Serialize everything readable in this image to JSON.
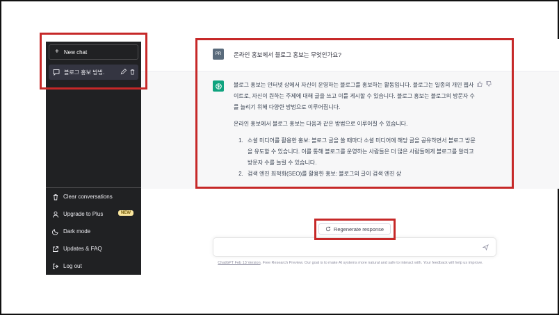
{
  "sidebar": {
    "new_chat_label": "New chat",
    "conversation_title": "블로그 홍보 방법.",
    "menu": [
      {
        "label": "Clear conversations",
        "icon": "trash-icon"
      },
      {
        "label": "Upgrade to Plus",
        "icon": "user-icon",
        "badge": "NEW"
      },
      {
        "label": "Dark mode",
        "icon": "moon-icon"
      },
      {
        "label": "Updates & FAQ",
        "icon": "external-link-icon"
      },
      {
        "label": "Log out",
        "icon": "logout-icon"
      }
    ]
  },
  "conversation": {
    "user_avatar": "PR",
    "question": "온라인 홍보에서 블로그 홍보는 무엇인가요?",
    "answer_p1": "블로그 홍보는 인터넷 상에서 자신이 운영하는 블로그를 홍보하는 활동입니다. 블로그는 일종의 개인 웹사이트로, 자신이 원하는 주제에 대해 글을 쓰고 이를 게시할 수 있습니다. 블로그 홍보는 블로그의 방문자 수를 늘리기 위해 다양한 방법으로 이루어집니다.",
    "answer_p2": "온라인 홍보에서 블로그 홍보는 다음과 같은 방법으로 이루어질 수 있습니다.",
    "answer_list": [
      "소셜 미디어를 활용한 홍보: 블로그 글을 쓸 때마다 소셜 미디어에 해당 글을 공유하면서 블로그 방문을 유도할 수 있습니다. 이를 통해 블로그를 운영하는 사람들은 더 많은 사람들에게 블로그를 알리고 방문자 수를 늘릴 수 있습니다.",
      "검색 엔진 최적화(SEO)를 활용한 홍보: 블로그의 글이 검색 엔진 상"
    ]
  },
  "regenerate_label": "Regenerate response",
  "input": {
    "placeholder": "",
    "value": ""
  },
  "footer": {
    "version_link": "ChatGPT Feb 13 Version",
    "text": ". Free Research Preview. Our goal is to make AI systems more natural and safe to interact with. Your feedback will help us improve."
  },
  "colors": {
    "sidebar_bg": "#202123",
    "accent": "#10a37f",
    "highlight": "#c62828"
  }
}
